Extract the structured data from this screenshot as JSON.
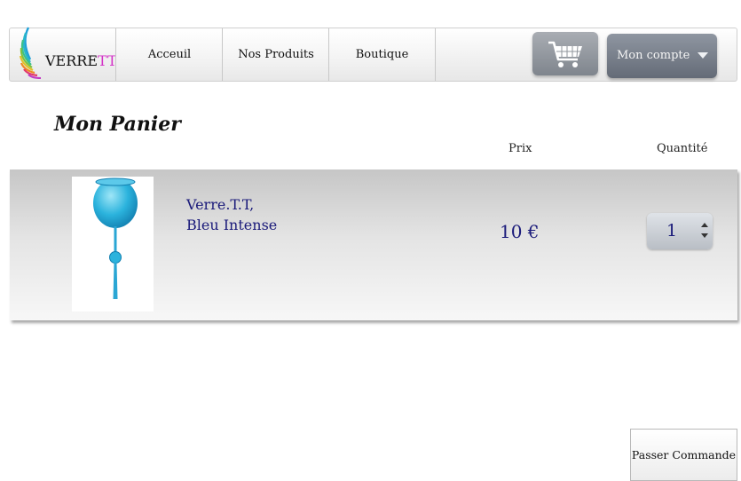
{
  "logo": {
    "text_main": "VERRE",
    "text_accent": "TT"
  },
  "nav": {
    "items": [
      {
        "label": "Acceuil"
      },
      {
        "label": "Nos Produits"
      },
      {
        "label": "Boutique"
      }
    ],
    "cart_icon": "cart-icon",
    "account_label": "Mon compte",
    "account_caret_icon": "caret-down-icon"
  },
  "cart": {
    "title": "Mon Panier",
    "columns": {
      "price": "Prix",
      "quantity": "Quantité"
    },
    "items": [
      {
        "name_line1": "Verre.T.T,",
        "name_line2": "Bleu Intense",
        "price": "10 €",
        "quantity": "1"
      }
    ]
  },
  "actions": {
    "order_label": "Passer Commande"
  },
  "colors": {
    "accent_text": "#1a1a7a",
    "logo_accent": "#d333c7",
    "product_glass": "#2bb3dd"
  }
}
